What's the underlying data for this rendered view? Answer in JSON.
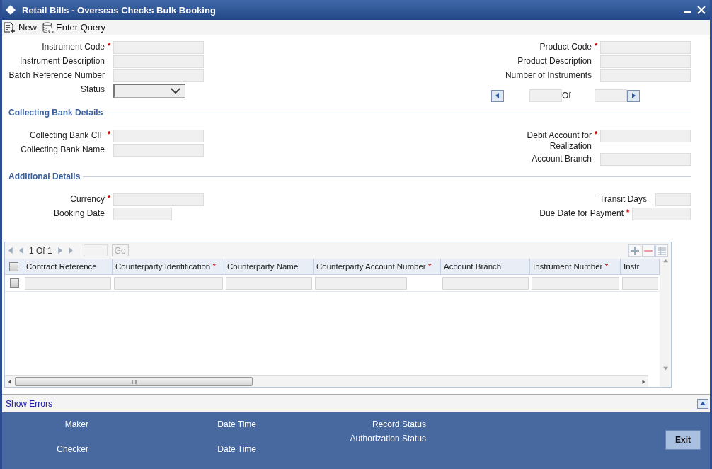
{
  "window": {
    "title": "Retail Bills - Overseas Checks Bulk Booking"
  },
  "toolbar": [
    {
      "label": "New",
      "kind": "new"
    },
    {
      "label": "Enter Query",
      "kind": "query"
    }
  ],
  "header": {
    "left": [
      {
        "label": "Instrument Code",
        "marker": "*",
        "kind": "text"
      },
      {
        "label": "Instrument Description",
        "kind": "text"
      },
      {
        "label": "Batch Reference Number",
        "kind": "text"
      },
      {
        "label": "Status",
        "kind": "select"
      }
    ],
    "right": [
      {
        "label": "Product Code",
        "marker": "*",
        "kind": "text"
      },
      {
        "label": "Product Description",
        "kind": "text"
      },
      {
        "label": "Number of Instruments",
        "kind": "text"
      }
    ],
    "pager": {
      "of": "Of"
    }
  },
  "sections": [
    {
      "title": "Collecting Bank Details",
      "left": [
        {
          "label": "Collecting Bank CIF",
          "marker": "*",
          "kind": "text"
        },
        {
          "label": "Collecting Bank Name",
          "kind": "text"
        }
      ],
      "right": [
        {
          "label": "Debit Account for\nRealization",
          "marker": "*",
          "kind": "text"
        },
        {
          "label": "Account Branch",
          "kind": "text"
        }
      ]
    },
    {
      "title": "Additional Details",
      "left": [
        {
          "label": "Currency",
          "marker": "*",
          "kind": "text"
        },
        {
          "label": "Booking Date",
          "kind": "date"
        }
      ],
      "right": [
        {
          "label": "Transit Days",
          "kind": "number"
        },
        {
          "label": "Due Date for Payment",
          "marker": "*",
          "kind": "date"
        }
      ]
    }
  ],
  "grid": {
    "pager": {
      "text": "1 Of 1",
      "go": "Go"
    },
    "columns": [
      {
        "label": "Contract Reference"
      },
      {
        "label": "Counterparty Identification",
        "marker": "*"
      },
      {
        "label": "Counterparty Name"
      },
      {
        "label": "Counterparty Account Number",
        "marker": "*"
      },
      {
        "label": "Account Branch"
      },
      {
        "label": "Instrument Number",
        "marker": "*"
      },
      {
        "label": "Instr"
      }
    ],
    "all_checked": false,
    "rows": [
      {
        "checked": false
      }
    ]
  },
  "errors_link": "Show Errors",
  "footer": {
    "cols": [
      [
        "Maker",
        "Checker"
      ],
      [
        "Date Time",
        "Date Time"
      ],
      [
        "Record Status",
        "Authorization Status"
      ]
    ],
    "exit": "Exit"
  }
}
